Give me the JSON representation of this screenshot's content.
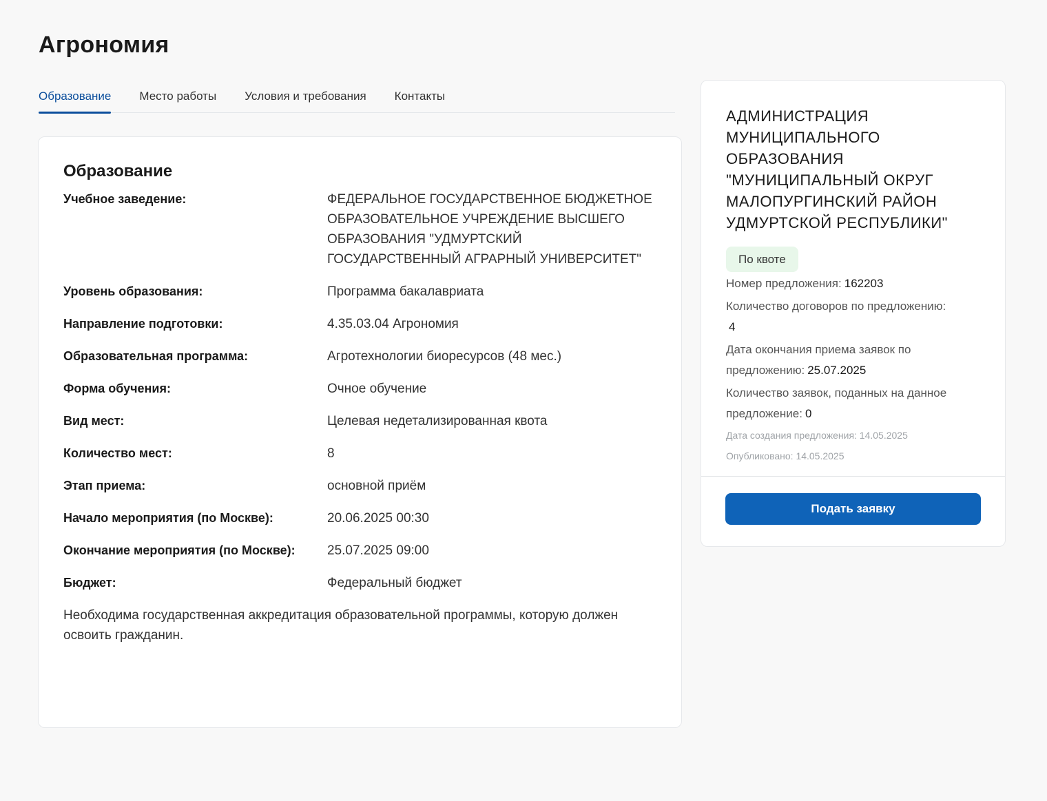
{
  "page": {
    "title": "Агрономия"
  },
  "tabs": [
    {
      "label": "Образование",
      "active": true
    },
    {
      "label": "Место работы",
      "active": false
    },
    {
      "label": "Условия и требования",
      "active": false
    },
    {
      "label": "Контакты",
      "active": false
    }
  ],
  "education": {
    "title": "Образование",
    "rows": [
      {
        "label": "Учебное заведение:",
        "value": "ФЕДЕРАЛЬНОЕ ГОСУДАРСТВЕННОЕ БЮДЖЕТНОЕ ОБРАЗОВАТЕЛЬНОЕ УЧРЕЖДЕНИЕ ВЫСШЕГО ОБРАЗОВАНИЯ \"УДМУРТСКИЙ ГОСУДАРСТВЕННЫЙ АГРАРНЫЙ УНИВЕРСИТЕТ\""
      },
      {
        "label": "Уровень образования:",
        "value": "Программа бакалавриата"
      },
      {
        "label": "Направление подготовки:",
        "value": "4.35.03.04 Агрономия"
      },
      {
        "label": "Образовательная программа:",
        "value": "Агротехнологии биоресурсов (48 мес.)"
      },
      {
        "label": "Форма обучения:",
        "value": "Очное обучение"
      },
      {
        "label": "Вид мест:",
        "value": "Целевая недетализированная квота"
      },
      {
        "label": "Количество мест:",
        "value": "8"
      },
      {
        "label": "Этап приема:",
        "value": "основной приём"
      },
      {
        "label": "Начало мероприятия (по Москве):",
        "value": "20.06.2025 00:30"
      },
      {
        "label": "Окончание мероприятия (по Москве):",
        "value": "25.07.2025 09:00"
      },
      {
        "label": "Бюджет:",
        "value": "Федеральный бюджет"
      }
    ],
    "note": "Необходима государственная аккредитация образовательной программы, которую должен освоить гражданин."
  },
  "side": {
    "org_name": "АДМИНИСТРАЦИЯ МУНИЦИПАЛЬНОГО ОБРАЗОВАНИЯ \"МУНИЦИПАЛЬНЫЙ ОКРУГ МАЛОПУРГИНСКИЙ РАЙОН УДМУРТСКОЙ РЕСПУБЛИКИ\"",
    "badge": "По квоте",
    "offer_number_label": "Номер предложения:",
    "offer_number": "162203",
    "contracts_label": "Количество договоров по предложению:",
    "contracts": "4",
    "deadline_label": "Дата окончания приема заявок по предложению:",
    "deadline": "25.07.2025",
    "applications_label": "Количество заявок, поданных на данное предложение:",
    "applications": "0",
    "created": "Дата создания предложения: 14.05.2025",
    "published": "Опубликовано: 14.05.2025",
    "submit_label": "Подать заявку"
  }
}
